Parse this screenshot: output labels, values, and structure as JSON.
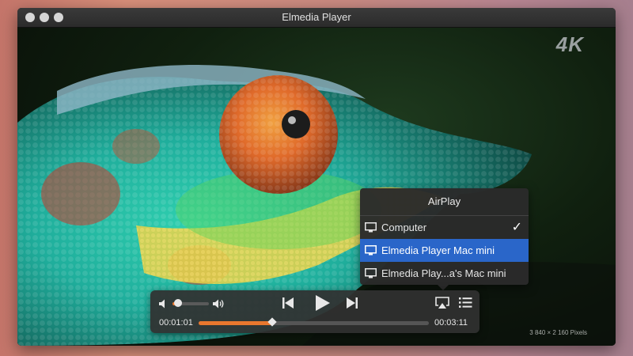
{
  "window": {
    "title": "Elmedia Player"
  },
  "video": {
    "quality_badge": "4K",
    "resolution_caption": "3 840 × 2 160 Pixels"
  },
  "airplay_menu": {
    "title": "AirPlay",
    "items": [
      {
        "label": "Computer",
        "checked": true
      },
      {
        "label": "Elmedia Player Mac mini",
        "selected": true
      },
      {
        "label": "Elmedia Play...a's Mac mini"
      }
    ]
  },
  "controls": {
    "current_time": "00:01:01",
    "duration": "00:03:11",
    "volume_level": 0.15,
    "progress": 0.32
  },
  "colors": {
    "accent": "#e8772e",
    "selection": "#2a66c9"
  },
  "icons": [
    "volume-low-icon",
    "volume-high-icon",
    "previous-icon",
    "play-icon",
    "next-icon",
    "airplay-icon",
    "playlist-icon",
    "monitor-icon",
    "checkmark-icon"
  ]
}
